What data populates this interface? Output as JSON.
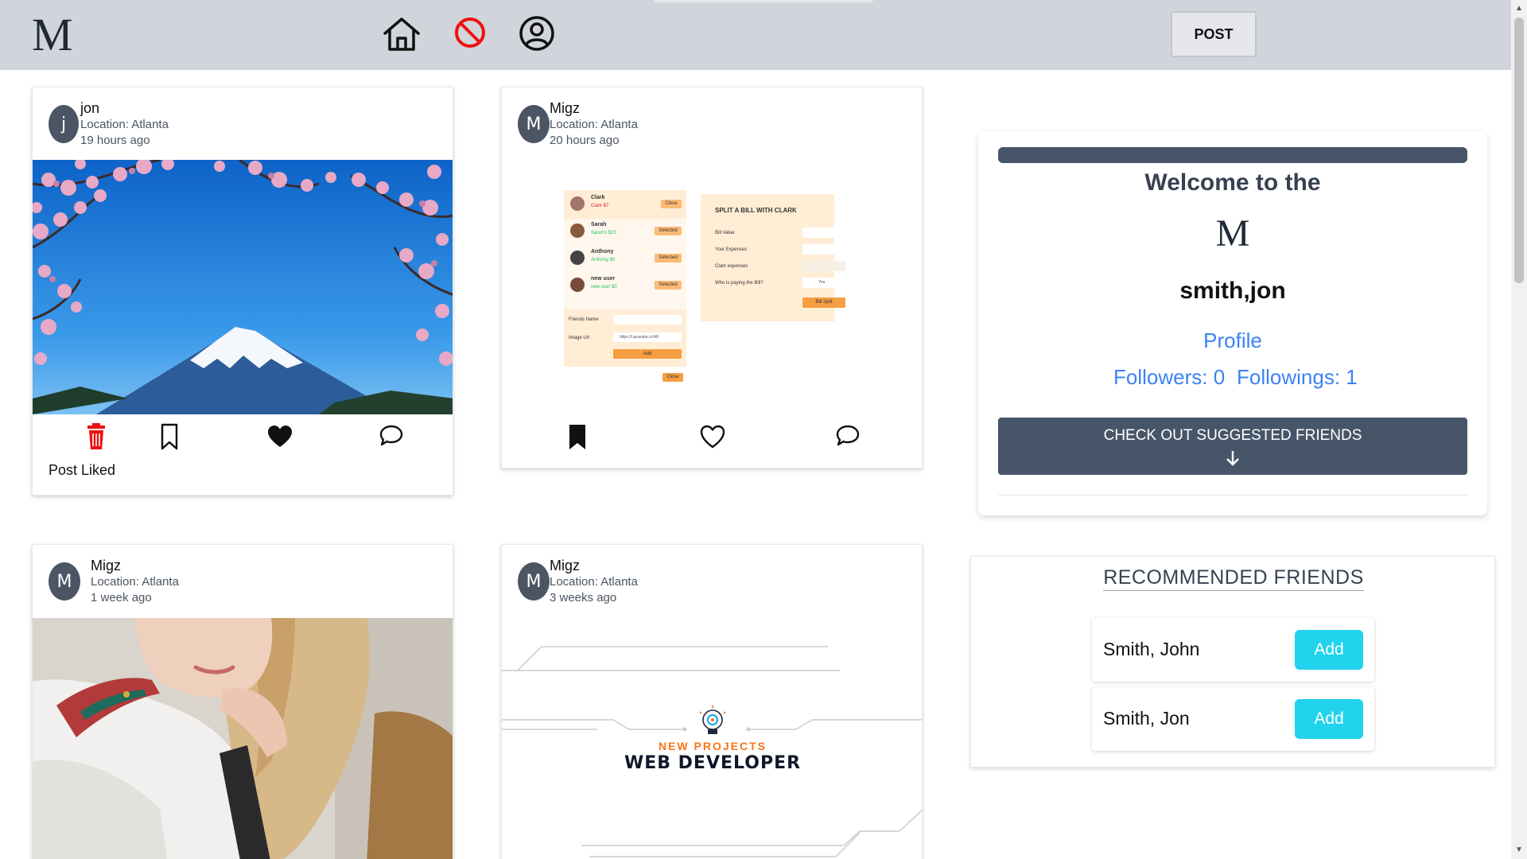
{
  "nav": {
    "logo": "M",
    "post_label": "POST"
  },
  "posts": [
    {
      "avatar": "j",
      "author": "jon",
      "location": "Location: Atlanta",
      "time": "19 hours ago",
      "status": "Post Liked",
      "image": "Mount Fuji with cherry blossoms"
    },
    {
      "avatar": "M",
      "author": "Migz",
      "location": "Location: Atlanta",
      "time": "20 hours ago",
      "image": "Split-a-bill app screenshot",
      "split_app": {
        "friends": [
          {
            "name": "Clark",
            "sub": "Clark $7",
            "btn": "Close"
          },
          {
            "name": "Sarah",
            "sub": "Sarah's $20",
            "btn": "Selected"
          },
          {
            "name": "Anthony",
            "sub": "Anthony $0",
            "btn": "Selected"
          },
          {
            "name": "new user",
            "sub": "new user $0",
            "btn": "Selected"
          }
        ],
        "form_title": "SPLIT A BILL WITH CLARK",
        "bill_value": "Bill Value",
        "your_expenses": "Your Expenses",
        "clark_expenses": "Clark expenses",
        "who_paying": "Who is paying the Bill?",
        "who_value": "You",
        "split_btn": "Bill Split",
        "friend_name_label": "Friends Name",
        "image_url_label": "Image Url",
        "image_url_value": "https://i.pravatar.cc/48",
        "add_btn": "Add",
        "close_btn": "Close"
      }
    },
    {
      "avatar": "M",
      "author": "Migz",
      "location": "Location: Atlanta",
      "time": "1 week ago",
      "image": "Woman in uniform with blonde hair"
    },
    {
      "avatar": "M",
      "author": "Migz",
      "location": "Location: Atlanta",
      "time": "3 weeks ago",
      "image": "New projects web developer banner",
      "banner_kicker": "NEW PROJECTS",
      "banner_title": "WEB DEVELOPER"
    }
  ],
  "profile": {
    "welcome": "Welcome to the",
    "logo": "M",
    "username": "smith,jon",
    "profile_link": "Profile",
    "followers": "Followers: 0",
    "followings": "Followings: 1",
    "suggest_label": "CHECK OUT SUGGESTED FRIENDS"
  },
  "recommended": {
    "title": "RECOMMENDED FRIENDS",
    "friends": [
      {
        "name": "Smith, John",
        "action": "Add"
      },
      {
        "name": "Smith, Jon",
        "action": "Add"
      }
    ]
  },
  "colors": {
    "nav_bg": "#d1d5db",
    "slate": "#475569",
    "link_blue": "#3b82f6",
    "cyan": "#22d3ee",
    "danger": "#ef1010"
  }
}
